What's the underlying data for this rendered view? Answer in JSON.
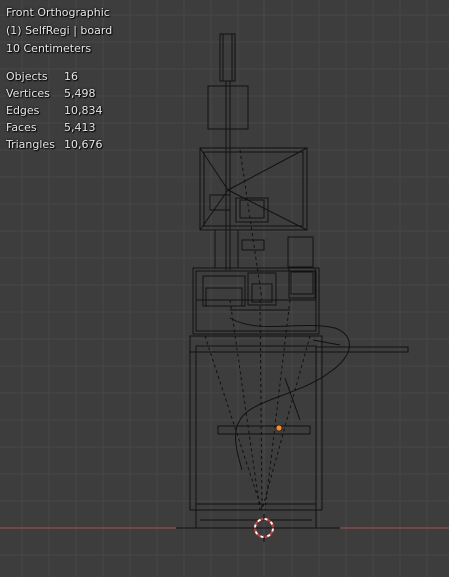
{
  "viewport": {
    "view_name": "Front Orthographic",
    "object_info": "(1) SelfRegi | board",
    "scale_label": "10 Centimeters"
  },
  "stats": [
    {
      "label": "Objects",
      "value": "16"
    },
    {
      "label": "Vertices",
      "value": "5,498"
    },
    {
      "label": "Edges",
      "value": "10,834"
    },
    {
      "label": "Faces",
      "value": "5,413"
    },
    {
      "label": "Triangles",
      "value": "10,676"
    }
  ],
  "colors": {
    "background": "#3d3d3d",
    "grid": "#474747",
    "x_axis": "#b34a4a",
    "wire": "#111111",
    "origin": "#ff8c1a",
    "cursor": "#ffffff"
  },
  "icons": [
    "3d-cursor-icon",
    "object-origin-icon"
  ]
}
